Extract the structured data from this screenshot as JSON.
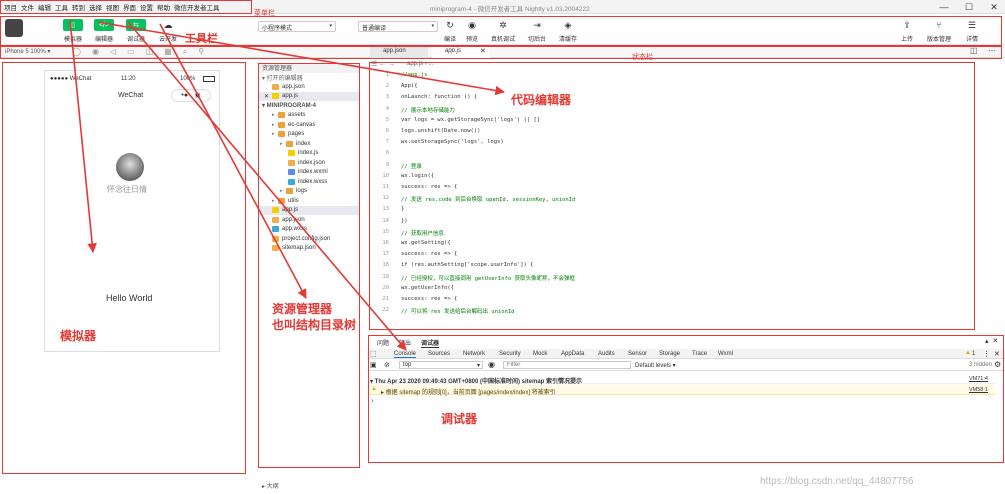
{
  "menu": {
    "items": [
      "项目",
      "文件",
      "编辑",
      "工具",
      "转到",
      "选择",
      "视图",
      "界面",
      "设置",
      "帮助",
      "微信开发者工具"
    ]
  },
  "window": {
    "title": "miniprogram-4 - 微信开发者工具 Nightly v1.03.2004222"
  },
  "toolbar": {
    "simulator": "模拟器",
    "editor": "编辑器",
    "debugger": "调试器",
    "cloud": "云开发",
    "mode": "小程序模式",
    "compile_mode": "普通编译",
    "compile": "编译",
    "preview": "预览",
    "real_debug": "真机调试",
    "switch_bg": "切后台",
    "clear_cache": "清缓存",
    "upload": "上传",
    "version": "版本管理",
    "detail": "详情"
  },
  "tabs": {
    "device": "iPhone 5 100% ▾",
    "tab1": "app.json",
    "tab2": "app.js"
  },
  "simulator": {
    "carrier": "●●●●● WeChat",
    "time": "11:20",
    "battery": "100%",
    "nav_title": "WeChat",
    "user_name": "怀念往日情",
    "hello": "Hello World"
  },
  "tree": {
    "header": "资源管理器",
    "open_editors": "▾ 打开的编辑器",
    "open_files": [
      "app.json",
      "app.js"
    ],
    "project": "▾ MINIPROGRAM-4",
    "items": [
      {
        "label": "assets",
        "indent": 1,
        "type": "folder"
      },
      {
        "label": "ec-canvas",
        "indent": 1,
        "type": "folder"
      },
      {
        "label": "pages",
        "indent": 1,
        "type": "folder"
      },
      {
        "label": "index",
        "indent": 2,
        "type": "folder"
      },
      {
        "label": "index.js",
        "indent": 3,
        "type": "js"
      },
      {
        "label": "index.json",
        "indent": 3,
        "type": "json"
      },
      {
        "label": "index.wxml",
        "indent": 3,
        "type": "wxml"
      },
      {
        "label": "index.wxss",
        "indent": 3,
        "type": "wxss"
      },
      {
        "label": "logs",
        "indent": 2,
        "type": "folder"
      },
      {
        "label": "utils",
        "indent": 1,
        "type": "folder"
      },
      {
        "label": "app.js",
        "indent": 1,
        "type": "js"
      },
      {
        "label": "app.json",
        "indent": 1,
        "type": "json"
      },
      {
        "label": "app.wxss",
        "indent": 1,
        "type": "wxss"
      },
      {
        "label": "project.config.json",
        "indent": 1,
        "type": "json"
      },
      {
        "label": "sitemap.json",
        "indent": 1,
        "type": "json"
      }
    ],
    "outline": "▸ 大纲"
  },
  "editor": {
    "breadcrumb": "app.js › ...",
    "lines": [
      "//app.js",
      "App({",
      "  onLaunch: function () {",
      "    // 展示本地存储能力",
      "    var logs = wx.getStorageSync('logs') || []",
      "    logs.unshift(Date.now())",
      "    wx.setStorageSync('logs', logs)",
      "",
      "    // 登录",
      "    wx.login({",
      "      success: res => {",
      "        // 发送 res.code 到后台换取 openId, sessionKey, unionId",
      "      }",
      "    })",
      "    // 获取用户信息",
      "    wx.getSetting({",
      "      success: res => {",
      "        if (res.authSetting['scope.userInfo']) {",
      "          // 已经授权，可以直接调用 getUserInfo 获取头像昵称，不会弹框",
      "          wx.getUserInfo({",
      "            success: res => {",
      "              // 可以将 res 发送给后台解码出 unionId"
    ]
  },
  "debugger": {
    "top_tabs": [
      "问题",
      "输出",
      "调试器"
    ],
    "tabs": [
      "Console",
      "Sources",
      "Network",
      "Security",
      "Mock",
      "AppData",
      "Audits",
      "Sensor",
      "Storage",
      "Trace",
      "Wxml"
    ],
    "context": "top",
    "filter_placeholder": "Filter",
    "levels": "Default levels ▾",
    "hidden": "3 hidden",
    "warn_count": "1",
    "log1": "▾ Thu Apr 23 2020 09:49:43 GMT+0800 (中国标准时间) sitemap 索引情况提示",
    "log1_src": "VM71:4",
    "log2": "▸ 根据 sitemap 的规则[0]，当前页面 [pages/index/index] 将被索引",
    "log2_src": "VM58:1",
    "prompt": "›"
  },
  "annotations": {
    "menubar": "菜单栏",
    "toolbar": "工具栏",
    "statusbar": "状态栏",
    "code_editor": "代码编辑器",
    "resource_manager": "资源管理器",
    "tree_alias": "也叫结构目录树",
    "simulator": "模拟器",
    "debugger": "调试器"
  },
  "watermark": "https://blog.csdn.net/qq_44807756",
  "colors": {
    "accent": "#07c160",
    "annotation": "#e53935",
    "keyword": "#0000ff",
    "comment": "#008000"
  }
}
